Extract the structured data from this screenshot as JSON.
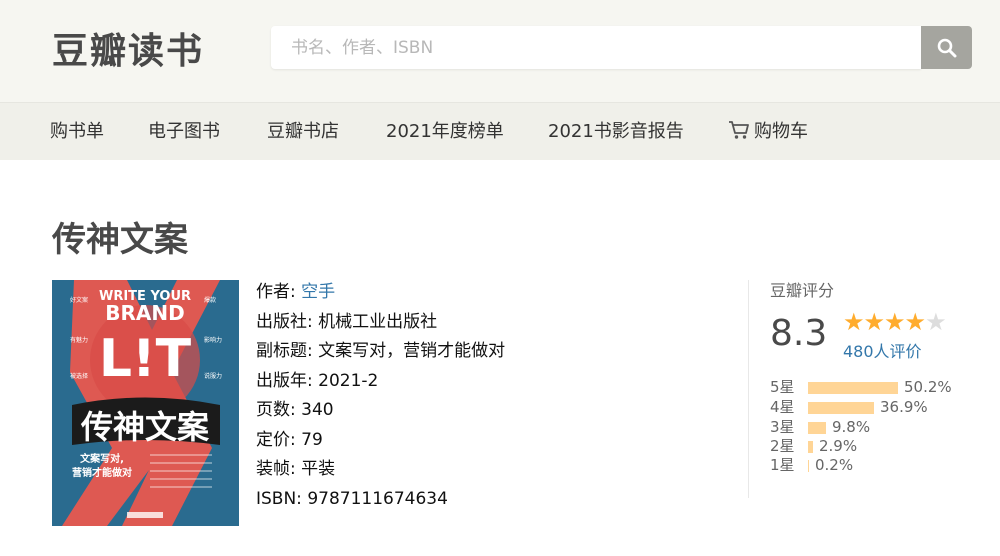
{
  "header": {
    "logo": "豆瓣读书",
    "search_placeholder": "书名、作者、ISBN"
  },
  "nav": {
    "items": [
      "购书单",
      "电子图书",
      "豆瓣书店",
      "2021年度榜单",
      "2021书影音报告"
    ],
    "cart_label": "购物车"
  },
  "book": {
    "title": "传神文案",
    "cover": {
      "top_text": "WRITE YOUR",
      "brand_text": "BRAND",
      "lit_text": "L!T",
      "cn_title": "传神文案",
      "subtitle_lines": [
        "文案写对,",
        "营销才能做对"
      ],
      "tags": [
        "好文案",
        "爆款",
        "有魅力",
        "影响力",
        "被选择",
        "说服力"
      ]
    },
    "info": [
      {
        "label": "作者:",
        "value": "空手",
        "is_link": true
      },
      {
        "label": "出版社:",
        "value": "机械工业出版社",
        "is_link": false
      },
      {
        "label": "副标题:",
        "value": "文案写对，营销才能做对",
        "is_link": false
      },
      {
        "label": "出版年:",
        "value": "2021-2",
        "is_link": false
      },
      {
        "label": "页数:",
        "value": "340",
        "is_link": false
      },
      {
        "label": "定价:",
        "value": "79",
        "is_link": false
      },
      {
        "label": "装帧:",
        "value": "平装",
        "is_link": false
      },
      {
        "label": "ISBN:",
        "value": "9787111674634",
        "is_link": false
      }
    ]
  },
  "rating": {
    "title": "豆瓣评分",
    "score": "8.3",
    "stars_filled": 4,
    "stars_total": 5,
    "count_text": "480人评价",
    "distribution": [
      {
        "label": "5星",
        "percent": 50.2,
        "text": "50.2%"
      },
      {
        "label": "4星",
        "percent": 36.9,
        "text": "36.9%"
      },
      {
        "label": "3星",
        "percent": 9.8,
        "text": "9.8%"
      },
      {
        "label": "2星",
        "percent": 2.9,
        "text": "2.9%"
      },
      {
        "label": "1星",
        "percent": 0.2,
        "text": "0.2%"
      }
    ]
  },
  "colors": {
    "link": "#3377aa",
    "star": "#ffac2d",
    "bar": "#ffd596"
  }
}
